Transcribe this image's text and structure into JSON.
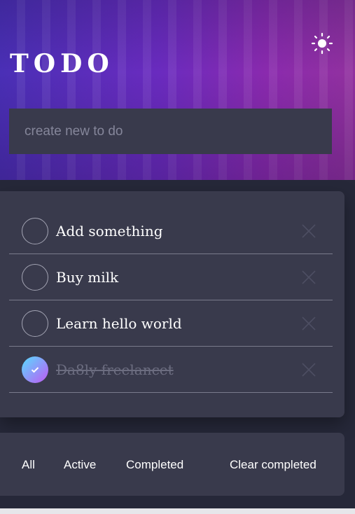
{
  "header": {
    "title": "TODO",
    "theme_icon": "sun-icon"
  },
  "new_todo": {
    "placeholder": "create new to do",
    "value": ""
  },
  "todos": [
    {
      "text": "Add something",
      "completed": false
    },
    {
      "text": "Buy milk",
      "completed": false
    },
    {
      "text": "Learn hello world",
      "completed": false
    },
    {
      "text": "Da8ly freelancet",
      "completed": true
    }
  ],
  "filters": {
    "all": "All",
    "active": "Active",
    "completed": "Completed",
    "clear": "Clear completed"
  },
  "colors": {
    "accent_start": "#57ddff",
    "accent_end": "#c058f3",
    "card": "#393a4c",
    "background": "#262839"
  }
}
